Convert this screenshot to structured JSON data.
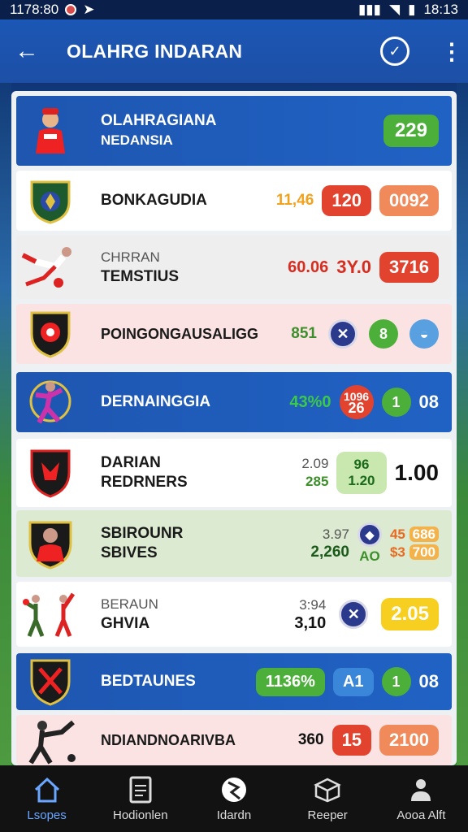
{
  "status": {
    "time": "1178:80",
    "clock": "18:13"
  },
  "appbar": {
    "title": "OLAHRG INDARAN"
  },
  "colors": {
    "primary": "#1e56b0",
    "accent_green": "#4caf3a",
    "accent_red": "#e2432f",
    "accent_orange": "#f08a5a",
    "accent_yellow": "#f7cf20"
  },
  "rows": [
    {
      "name": "OLAHRAGIANA",
      "sub": "NEDANSIA",
      "v1": "229"
    },
    {
      "name": "BONKAGUDIA",
      "v1": "11,46",
      "v2": "120",
      "v3": "0092"
    },
    {
      "name": "TEMSTIUS",
      "sub": "CHRRAN",
      "v1": "60.06",
      "v2": "3Y.0",
      "v3": "3716"
    },
    {
      "name": "POINGONGAUSALIGG",
      "v1": "851",
      "v2": "8"
    },
    {
      "name": "DERNAINGGIA",
      "v1": "43%0",
      "v2a": "1096",
      "v2b": "26",
      "v3": "1",
      "v4": "08"
    },
    {
      "name": "DARIAN",
      "sub": "REDRNERS",
      "v1a": "2.09",
      "v1b": "285",
      "v2a": "96",
      "v2b": "1.20",
      "v3": "1.00"
    },
    {
      "name": "SBIROUNR",
      "sub": "SBIVES",
      "v1a": "3.97",
      "v1b": "2,260",
      "v2": "AO",
      "v3a": "45",
      "v3b": "686",
      "v3c": "$3",
      "v3d": "700"
    },
    {
      "name": "BERAUN",
      "sub": "GHVIA",
      "v1a": "3:94",
      "v1b": "3,10",
      "v2": "2.05"
    },
    {
      "name": "BEDTAUNES",
      "v1": "1136%",
      "v2": "A1",
      "v3": "1",
      "v4": "08"
    },
    {
      "name": "NDIANDNOARIVBA",
      "v1": "360",
      "v2": "15",
      "v3": "2100"
    }
  ],
  "nav": [
    {
      "label": "Lsopes",
      "icon": "home-icon"
    },
    {
      "label": "Hodionlen",
      "icon": "document-icon"
    },
    {
      "label": "Idardn",
      "icon": "globe-icon"
    },
    {
      "label": "Reeper",
      "icon": "box-icon"
    },
    {
      "label": "Aooa Alft",
      "icon": "person-icon"
    }
  ]
}
